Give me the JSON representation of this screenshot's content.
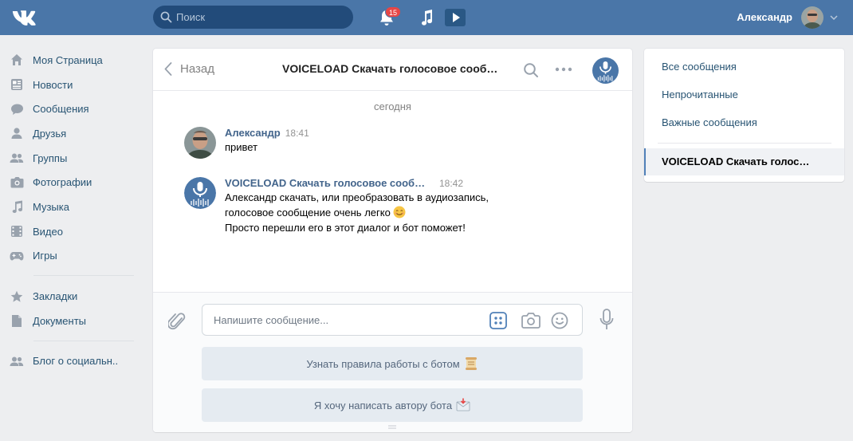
{
  "header": {
    "search_placeholder": "Поиск",
    "notifications_count": "15",
    "user_name": "Александр"
  },
  "nav": {
    "items": [
      {
        "label": "Моя Страница",
        "icon": "home-icon"
      },
      {
        "label": "Новости",
        "icon": "news-icon"
      },
      {
        "label": "Сообщения",
        "icon": "messages-icon"
      },
      {
        "label": "Друзья",
        "icon": "friends-icon"
      },
      {
        "label": "Группы",
        "icon": "groups-icon"
      },
      {
        "label": "Фотографии",
        "icon": "photos-icon"
      },
      {
        "label": "Музыка",
        "icon": "music-icon"
      },
      {
        "label": "Видео",
        "icon": "video-icon"
      },
      {
        "label": "Игры",
        "icon": "games-icon"
      }
    ],
    "secondary": [
      {
        "label": "Закладки",
        "icon": "star-icon"
      },
      {
        "label": "Документы",
        "icon": "document-icon"
      }
    ],
    "tertiary": [
      {
        "label": "Блог о социальн..",
        "icon": "people-icon"
      }
    ]
  },
  "chat": {
    "back_label": "Назад",
    "title": "VOICELOAD Скачать голосовое сообщение",
    "date_separator": "сегодня",
    "messages": [
      {
        "author": "Александр",
        "time": "18:41",
        "lines": [
          "привет"
        ]
      },
      {
        "author": "VOICELOAD Скачать голосовое сообщение",
        "time": "18:42",
        "lines": [
          "Александр скачать, или преобразовать в аудиозапись,",
          "голосовое сообщение очень легко",
          "Просто перешли его в этот диалог и бот поможет!"
        ]
      }
    ],
    "composer": {
      "placeholder": "Напишите сообщение..."
    },
    "bot_buttons": [
      {
        "label": "Узнать правила работы с ботом"
      },
      {
        "label": "Я хочу написать автору бота"
      }
    ]
  },
  "right_menu": {
    "items": [
      "Все сообщения",
      "Непрочитанные",
      "Важные сообщения"
    ],
    "active_chat": "VOICELOAD Скачать голосовое сообщение"
  },
  "colors": {
    "header": "#4a76a8",
    "link": "#285473",
    "author": "#42648b",
    "badge": "#e64646"
  }
}
